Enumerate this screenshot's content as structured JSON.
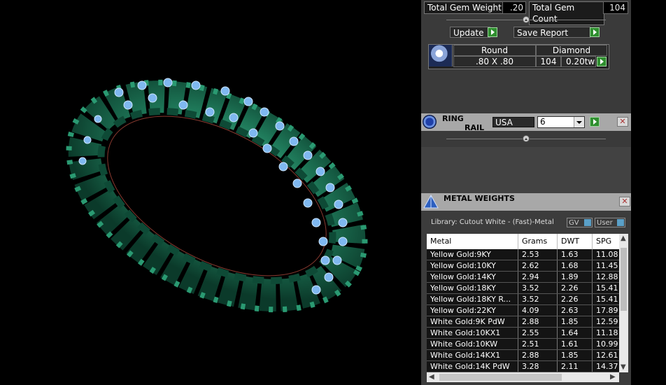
{
  "gem_summary": {
    "total_gem_weight_label": "Total Gem Weight",
    "total_gem_weight_value": ".20",
    "total_gem_count_label": "Total Gem Count",
    "total_gem_count_value": "104",
    "update_label": "Update",
    "save_report_label": "Save Report"
  },
  "gem_row": {
    "cut": "Round",
    "type": "Diamond",
    "size": ".80 X .80",
    "count": "104",
    "weight": "0.20tw"
  },
  "ring_rail": {
    "title_line1": "RING",
    "title_line2": "RAIL",
    "standard": "USA",
    "size": "6"
  },
  "metal_weights": {
    "title": "METAL WEIGHTS",
    "library": "Library: Cutout White - (Fast)-Metal",
    "gv_label": "GV",
    "user_label": "User",
    "columns": [
      "Metal",
      "Grams",
      "DWT",
      "SPG"
    ],
    "rows": [
      [
        "Yellow Gold:9KY",
        "2.53",
        "1.63",
        "11.08"
      ],
      [
        "Yellow Gold:10KY",
        "2.62",
        "1.68",
        "11.45"
      ],
      [
        "Yellow Gold:14KY",
        "2.94",
        "1.89",
        "12.88"
      ],
      [
        "Yellow Gold:18KY",
        "3.52",
        "2.26",
        "15.41"
      ],
      [
        "Yellow Gold:18KY R...",
        "3.52",
        "2.26",
        "15.41"
      ],
      [
        "Yellow Gold:22KY",
        "4.09",
        "2.63",
        "17.89"
      ],
      [
        "White Gold:9K PdW",
        "2.88",
        "1.85",
        "12.59"
      ],
      [
        "White Gold:10KX1",
        "2.55",
        "1.64",
        "11.18"
      ],
      [
        "White Gold:10KW",
        "2.51",
        "1.61",
        "10.99"
      ],
      [
        "White Gold:14KX1",
        "2.88",
        "1.85",
        "12.61"
      ],
      [
        "White Gold:14K PdW",
        "3.28",
        "2.11",
        "14.37"
      ]
    ]
  },
  "colors": {
    "ring_metal": "#1f7a5a",
    "gem_blue": "#7fb8f0",
    "go_button": "#2f8f2f"
  }
}
